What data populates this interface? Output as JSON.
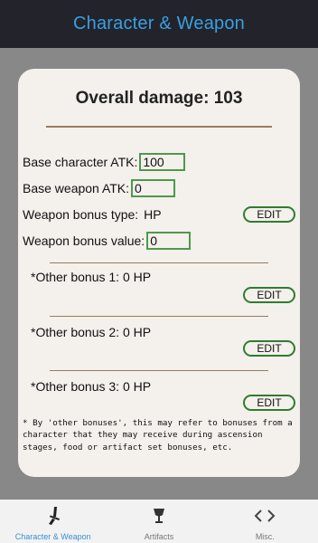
{
  "app": {
    "title": "Character & Weapon"
  },
  "card": {
    "overall_label": "Overall damage: 103",
    "base_character_atk_label": "Base character ATK:",
    "base_character_atk_value": "100",
    "base_weapon_atk_label": "Base weapon ATK:",
    "base_weapon_atk_value": "0",
    "weapon_bonus_type_label": "Weapon bonus type:",
    "weapon_bonus_type_value": "HP",
    "weapon_bonus_value_label": "Weapon bonus value:",
    "weapon_bonus_value_value": "0",
    "edit_label": "EDIT",
    "other_bonuses": [
      "*Other bonus 1: 0 HP",
      "*Other bonus 2: 0 HP",
      "*Other bonus 3: 0 HP"
    ],
    "note": "* By 'other bonuses', this may refer to bonuses from a character that they may receive during ascension stages, food or artifact set bonuses, etc."
  },
  "nav": [
    {
      "label": "Character & Weapon",
      "icon": "sword-icon",
      "active": true
    },
    {
      "label": "Artifacts",
      "icon": "goblet-icon",
      "active": false
    },
    {
      "label": "Misc.",
      "icon": "code-brackets-icon",
      "active": false
    }
  ],
  "colors": {
    "appbar": "#22232b",
    "title": "#3aa0e0",
    "accent_green": "#2f7d2f",
    "divider": "#9a7b5a",
    "card": "#f4f0ec",
    "nav_active": "#3a8ed0"
  }
}
